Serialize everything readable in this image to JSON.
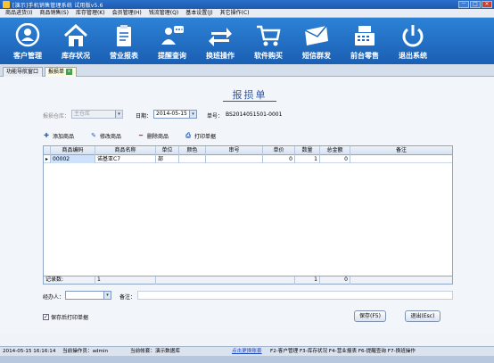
{
  "window": {
    "title": "[演示]手机销售管理系统  试用版v5.6",
    "buttons": [
      "－",
      "□",
      "×"
    ]
  },
  "menu": [
    "商品进货(I)",
    "商品销售(S)",
    "库存管理(K)",
    "会员管理(H)",
    "钱流管理(Q)",
    "基本设置(J)",
    "其它操作(C)"
  ],
  "toolbar": [
    {
      "label": "客户管理",
      "icon": "person-icon"
    },
    {
      "label": "库存状况",
      "icon": "house-icon"
    },
    {
      "label": "营业报表",
      "icon": "clipboard-icon"
    },
    {
      "label": "提醒查询",
      "icon": "people-icon"
    },
    {
      "label": "换班操作",
      "icon": "swap-icon"
    },
    {
      "label": "软件购买",
      "icon": "cart-icon"
    },
    {
      "label": "短信群发",
      "icon": "envelope-icon"
    },
    {
      "label": "前台零售",
      "icon": "register-icon"
    },
    {
      "label": "退出系统",
      "icon": "power-icon"
    }
  ],
  "tabs": [
    {
      "label": "功能导航窗口"
    },
    {
      "label": "报损单",
      "close": "x"
    }
  ],
  "form": {
    "title": "报损单",
    "warehouse_label": "报损仓库：",
    "warehouse_value": "主仓库",
    "date_label": "日期：",
    "date_value": "2014-05-15",
    "docno_label": "单号：",
    "docno_value": "BS2014051501-0001"
  },
  "actions": [
    {
      "label": "添加商品",
      "icon": "plus-icon",
      "glyph": "✚"
    },
    {
      "label": "修改商品",
      "icon": "edit-icon",
      "glyph": "✎"
    },
    {
      "label": "删除商品",
      "icon": "minus-icon",
      "glyph": "━"
    },
    {
      "label": "打印单据",
      "icon": "printer-icon",
      "glyph": "⎙"
    }
  ],
  "table": {
    "columns": [
      "商品编码",
      "商品名称",
      "单位",
      "颜色",
      "串号",
      "单价",
      "数量",
      "总金额",
      "备注"
    ],
    "rows": [
      {
        "marker": "▸",
        "code": "00002",
        "name": "诺基亚C7",
        "unit": "部",
        "color": "",
        "serial": "",
        "price": "0",
        "qty": "1",
        "amount": "0",
        "note": ""
      }
    ],
    "footer": {
      "label": "记录数:",
      "count": "1",
      "qty_total": "1",
      "amount_total": "0"
    }
  },
  "bottom": {
    "handler_label": "经办人：",
    "remark_label": "备注：",
    "checkbox_label": "保存后打印单据",
    "checkbox_checked": true,
    "save_button": "保存(F5)",
    "exit_button": "退出(Esc)"
  },
  "status": {
    "datetime": "2014-05-15 16:16:14",
    "operator": "当前操作员：admin",
    "account": "当前帐套：演示数据库",
    "link": "点击更换账套",
    "shortcuts": "F2-客户管理  F3-库存状况  F4-营业报表  F6-提醒查询  F7-换班操作"
  }
}
